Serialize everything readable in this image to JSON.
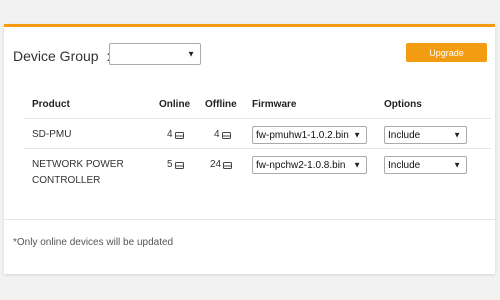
{
  "device_group": {
    "label": "Device Group  :",
    "selected": ""
  },
  "upgrade_button": "Upgrade",
  "table": {
    "headers": {
      "product": "Product",
      "online": "Online",
      "offline": "Offline",
      "firmware": "Firmware",
      "options": "Options"
    },
    "rows": [
      {
        "product": "SD-PMU",
        "online": "4",
        "offline": "4",
        "firmware": "fw-pmuhw1-1.0.2.bin",
        "option": "Include"
      },
      {
        "product": "NETWORK POWER CONTROLLER",
        "online": "5",
        "offline": "24",
        "firmware": "fw-npchw2-1.0.8.bin",
        "option": "Include"
      }
    ]
  },
  "note": "*Only online devices will be updated",
  "colors": {
    "accent": "#f39c12",
    "divider": "#e6e6e6"
  },
  "icons": {
    "device": "device-icon",
    "dropdown": "chevron-down-icon"
  }
}
